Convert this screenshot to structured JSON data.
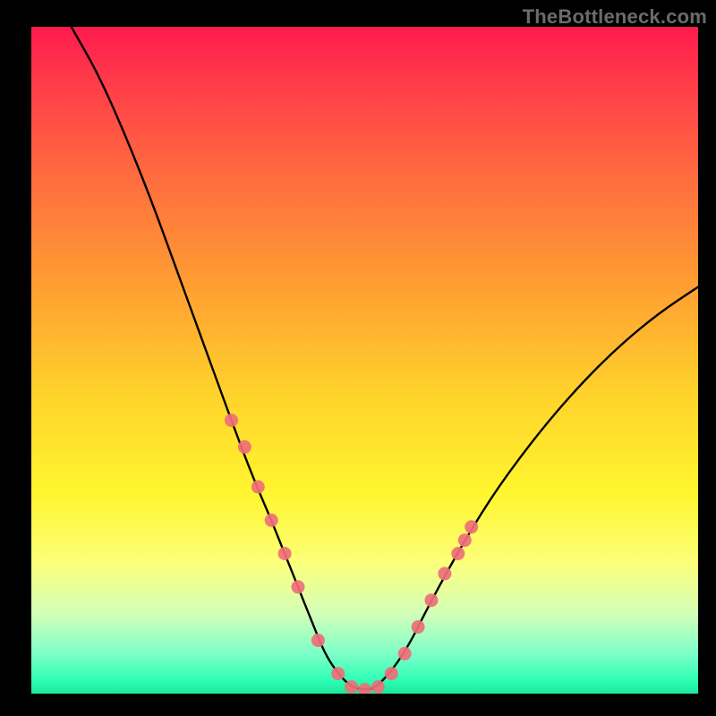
{
  "watermark": "TheBottleneck.com",
  "chart_data": {
    "type": "line",
    "title": "",
    "xlabel": "",
    "ylabel": "",
    "xlim": [
      0,
      100
    ],
    "ylim": [
      0,
      100
    ],
    "series": [
      {
        "name": "bottleneck-curve",
        "x": [
          6,
          10,
          14,
          18,
          22,
          26,
          30,
          33,
          36,
          38,
          40,
          42,
          44,
          46,
          48,
          50,
          52,
          56,
          60,
          65,
          70,
          76,
          82,
          88,
          94,
          100
        ],
        "y": [
          100,
          93,
          84,
          74,
          63,
          52,
          41,
          33,
          26,
          21,
          16,
          11,
          6,
          3,
          1,
          0.5,
          1,
          6,
          14,
          23,
          31,
          39,
          46,
          52,
          57,
          61
        ]
      }
    ],
    "markers": {
      "name": "highlight-dots",
      "color": "#ef6f78",
      "x": [
        30,
        32,
        34,
        36,
        38,
        40,
        43,
        46,
        48,
        50,
        52,
        54,
        56,
        58,
        60,
        62,
        64,
        65,
        66
      ],
      "y": [
        41,
        37,
        31,
        26,
        21,
        16,
        8,
        3,
        1,
        0.6,
        1,
        3,
        6,
        10,
        14,
        18,
        21,
        23,
        25
      ]
    },
    "background_gradient": [
      "#ff1a4d",
      "#ffd22b",
      "#fff62f",
      "#2fffb5"
    ]
  }
}
